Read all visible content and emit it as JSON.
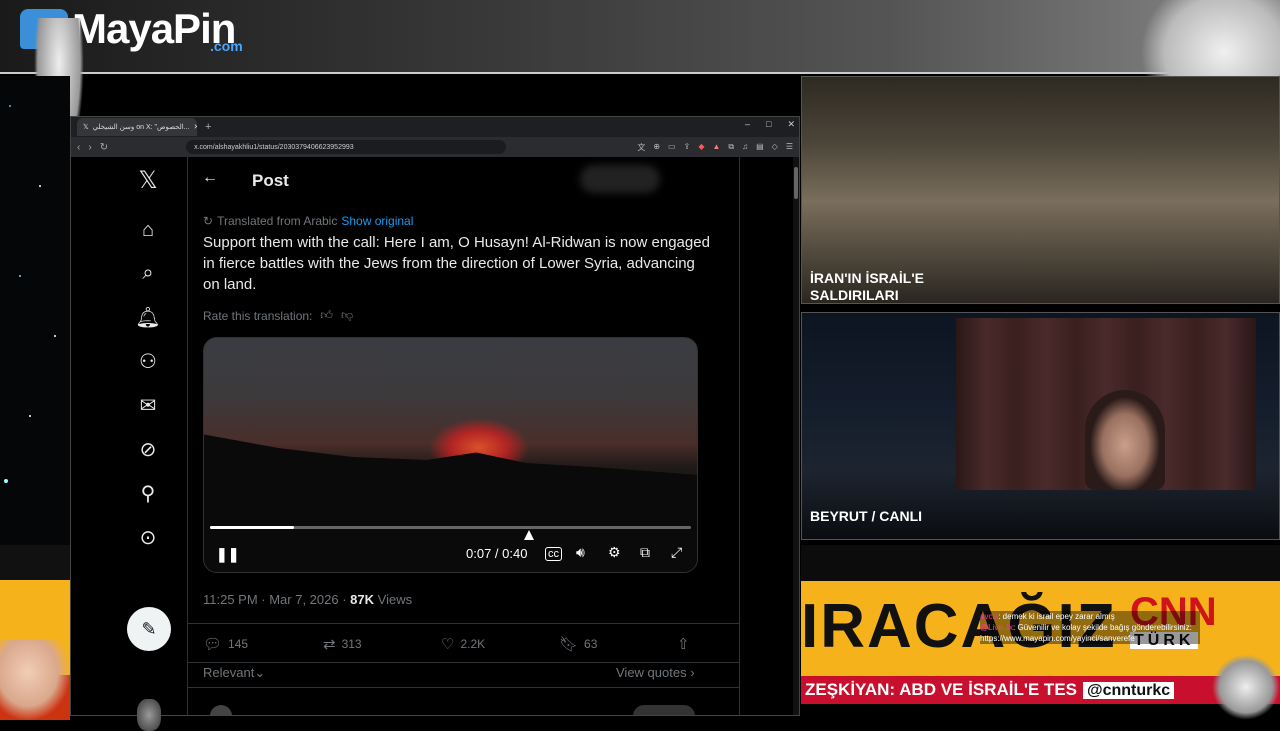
{
  "overlay": {
    "logo_text": "MayaPin",
    "logo_suffix": ".com",
    "panel1_label": "İRAN'IN İSRAİL'E SALDIRILARI",
    "panel2_label_city": "BEYRUT",
    "panel2_label_status": "CANLI",
    "news_big": "IRACAĞIZ",
    "cnn": "CNN",
    "turk": "TÜRK",
    "ticker_text": "ZEŞKİYAN: ABD VE İSRAİL'E TES",
    "ticker_handle": "@cnnturkc",
    "chat": [
      {
        "user": "avcis",
        "text": ": demek ki israil epey zarar almış"
      },
      {
        "user": "@Live.Jx",
        "text": ": Güvenilir ve kolay şekilde bağış gönderebilirsiniz:"
      },
      {
        "user": "",
        "text": "https://www.mayapin.com/yayinci/sanverefe"
      }
    ]
  },
  "browser": {
    "tab_title": "وسن الشيخلي on X: \"الحصوص...",
    "new_tab": "+",
    "url": "x.com/alshayakhliu1/status/2030379406623952993",
    "window_controls": [
      "–",
      "□",
      "✕"
    ]
  },
  "x": {
    "header_title": "Post",
    "translated_from": "Translated from Arabic",
    "show_original": "Show original",
    "post_text": "Support them with the call: Here I am, O Husayn! Al-Ridwan is now engaged in fierce battles with the Jews from the direction of Lower Syria, advancing on land.",
    "rate_translation": "Rate this translation:",
    "video": {
      "time": "0:07 / 0:40",
      "progress": 0.175
    },
    "meta_time": "11:25 PM · Mar 7, 2026 · ",
    "views_count": "87K",
    "views_label": " Views",
    "actions": {
      "replies": "145",
      "reposts": "313",
      "likes": "2.2K",
      "bookmarks": "63"
    },
    "relevant": "Relevant",
    "view_quotes": "View quotes"
  },
  "colors": {
    "accent": "#1d9bf0",
    "news_yellow": "#f5b21a",
    "ticker_red": "#c8102e"
  }
}
